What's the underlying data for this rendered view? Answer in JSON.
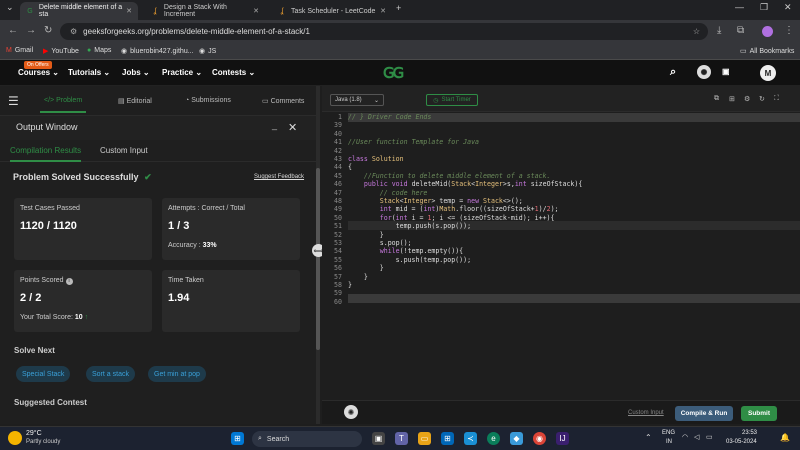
{
  "browser": {
    "tabs": [
      {
        "title": "Delete middle element of a sta",
        "icon": "gfg-favicon"
      },
      {
        "title": "Design a Stack With Increment",
        "icon": "leetcode-favicon"
      },
      {
        "title": "Task Scheduler - LeetCode",
        "icon": "leetcode-favicon"
      }
    ],
    "new_tab": "+",
    "url": "geeksforgeeks.org/problems/delete-middle-element-of-a-stack/1",
    "bookmarks": [
      "Gmail",
      "YouTube",
      "Maps",
      "bluerobin427.githu...",
      "JS"
    ],
    "all_bookmarks": "All Bookmarks"
  },
  "site": {
    "nav": [
      "Courses",
      "Tutorials",
      "Jobs",
      "Practice",
      "Contests"
    ],
    "offer_badge": "On Offers",
    "logo": "GfG",
    "avatar": "M"
  },
  "left": {
    "tabs": [
      "Problem",
      "Editorial",
      "Submissions",
      "Comments"
    ],
    "output_title": "Output Window",
    "subtabs": [
      "Compilation Results",
      "Custom Input"
    ],
    "status": "Problem Solved Successfully",
    "feedback": "Suggest Feedback",
    "cards": {
      "tests": {
        "label": "Test Cases Passed",
        "value": "1120 / 1120"
      },
      "attempts": {
        "label": "Attempts : Correct / Total",
        "value": "1 / 3",
        "sub_label": "Accuracy :",
        "sub_value": "33%"
      },
      "points": {
        "label": "Points Scored",
        "value": "2 / 2",
        "sub_label": "Your Total Score:",
        "sub_value": "10"
      },
      "time": {
        "label": "Time Taken",
        "value": "1.94"
      }
    },
    "solve_next_title": "Solve Next",
    "solve_next": [
      "Special Stack",
      "Sort a stack",
      "Get min at pop"
    ],
    "suggested_contest": "Suggested Contest"
  },
  "editor": {
    "language": "Java (1.8)",
    "timer": "Start Timer",
    "lines": [
      {
        "n": "1",
        "t": "// } Driver Code Ends"
      },
      {
        "n": "39",
        "t": ""
      },
      {
        "n": "40",
        "t": ""
      },
      {
        "n": "41",
        "t": "//User function Template for Java"
      },
      {
        "n": "42",
        "t": ""
      },
      {
        "n": "43",
        "t": "class Solution"
      },
      {
        "n": "44",
        "t": "{"
      },
      {
        "n": "45",
        "t": "    //Function to delete middle element of a stack."
      },
      {
        "n": "46",
        "t": "    public void deleteMid(Stack<Integer>s,int sizeOfStack){"
      },
      {
        "n": "47",
        "t": "        // code here"
      },
      {
        "n": "48",
        "t": "        Stack<Integer> temp = new Stack<>();"
      },
      {
        "n": "49",
        "t": "        int mid = (int)Math.floor((sizeOfStack+1)/2);"
      },
      {
        "n": "50",
        "t": "        for(int i = 1; i <= (sizeOfStack-mid); i++){"
      },
      {
        "n": "51",
        "t": "            temp.push(s.pop());"
      },
      {
        "n": "52",
        "t": "        }"
      },
      {
        "n": "53",
        "t": "        s.pop();"
      },
      {
        "n": "54",
        "t": "        while(!temp.empty()){"
      },
      {
        "n": "55",
        "t": "            s.push(temp.pop());"
      },
      {
        "n": "56",
        "t": "        }"
      },
      {
        "n": "57",
        "t": "    }"
      },
      {
        "n": "58",
        "t": "}"
      },
      {
        "n": "59",
        "t": ""
      },
      {
        "n": "60",
        "t": ""
      }
    ],
    "custom_input": "Custom Input",
    "compile_run": "Compile & Run",
    "submit": "Submit"
  },
  "taskbar": {
    "temp": "29°C",
    "weather": "Partly cloudy",
    "search": "Search",
    "lang1": "ENG",
    "lang2": "IN",
    "time": "23:53",
    "date": "03-05-2024"
  },
  "colors": {
    "accent": "#2f8d46",
    "link": "#3aa0d8"
  }
}
